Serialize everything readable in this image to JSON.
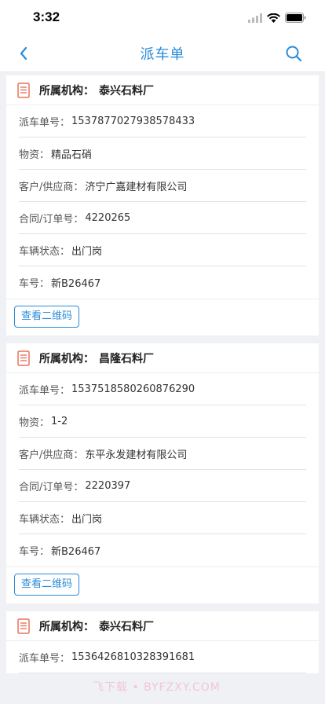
{
  "status_bar": {
    "time": "3:32"
  },
  "nav": {
    "title": "派车单"
  },
  "colors": {
    "accent": "#2a8bd8",
    "org_icon": "#e8735a"
  },
  "cards": [
    {
      "org_label": "所属机构：",
      "org_value": "泰兴石料厂",
      "fields": [
        {
          "label": "派车单号：",
          "value": "1537877027938578433"
        },
        {
          "label": "物资：",
          "value": "精品石硝"
        },
        {
          "label": "客户/供应商：",
          "value": "济宁广嘉建材有限公司"
        },
        {
          "label": "合同/订单号：",
          "value": "4220265"
        },
        {
          "label": "车辆状态：",
          "value": "出门岗"
        },
        {
          "label": "车号：",
          "value": "新B26467"
        }
      ],
      "button_label": "查看二维码"
    },
    {
      "org_label": "所属机构：",
      "org_value": "昌隆石料厂",
      "fields": [
        {
          "label": "派车单号：",
          "value": "1537518580260876290"
        },
        {
          "label": "物资：",
          "value": "1-2"
        },
        {
          "label": "客户/供应商：",
          "value": "东平永发建材有限公司"
        },
        {
          "label": "合同/订单号：",
          "value": "2220397"
        },
        {
          "label": "车辆状态：",
          "value": "出门岗"
        },
        {
          "label": "车号：",
          "value": "新B26467"
        }
      ],
      "button_label": "查看二维码"
    },
    {
      "org_label": "所属机构：",
      "org_value": "泰兴石料厂",
      "fields": [
        {
          "label": "派车单号：",
          "value": "1536426810328391681"
        }
      ]
    }
  ],
  "watermark": "飞下载 • BYFZXY.COM"
}
